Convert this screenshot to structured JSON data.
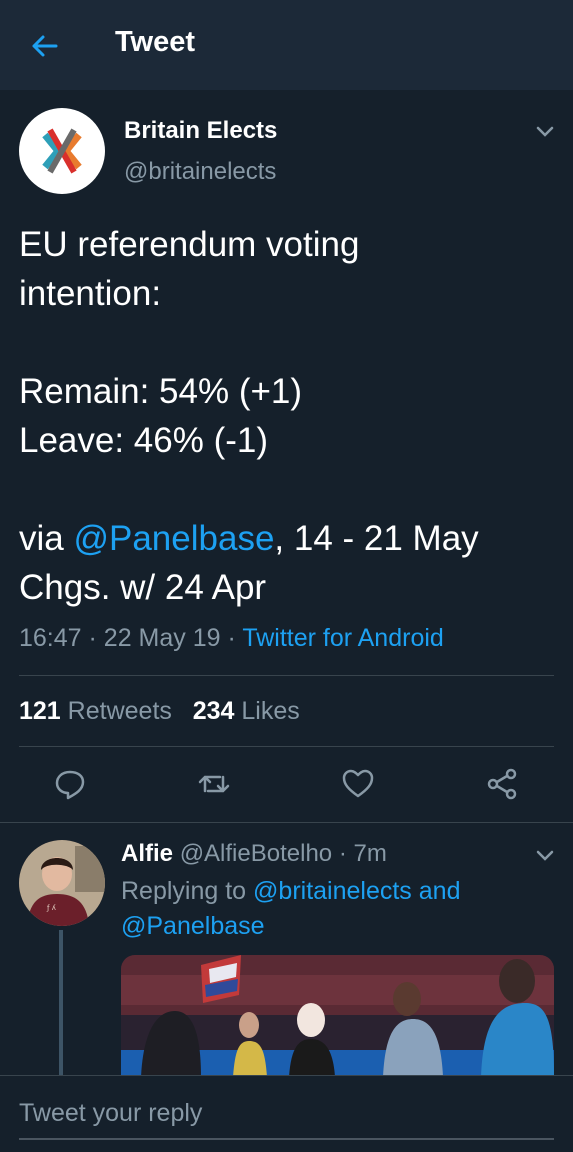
{
  "header": {
    "title": "Tweet"
  },
  "tweet": {
    "author_name": "Britain Elects",
    "author_handle": "@britainelects",
    "lines": [
      "EU referendum voting",
      "intention:",
      "",
      "Remain: 54% (+1)",
      "Leave: 46% (-1)",
      ""
    ],
    "via_prefix": "via ",
    "via_mention": "@Panelbase",
    "via_suffix": ", 14 - 21 May",
    "last_line": "Chgs. w/ 24 Apr",
    "time": "16:47",
    "date": "22 May 19",
    "app": "Twitter for Android",
    "dot": "·",
    "retweets_count": "121",
    "retweets_label": "Retweets",
    "likes_count": "234",
    "likes_label": "Likes"
  },
  "reply": {
    "name": "Alfie",
    "handle": "@AlfieBotelho",
    "age": "7m",
    "replying_prefix": "Replying to ",
    "mention1": "@britainelects",
    "conjunction": " and",
    "mention2": "@Panelbase"
  },
  "composer": {
    "placeholder": "Tweet your reply"
  },
  "colors": {
    "background": "#15202b",
    "header": "#1c2938",
    "accent": "#1da1f2",
    "muted": "#8899a6",
    "divider": "#38444d"
  },
  "icons": [
    "back-arrow-icon",
    "chevron-down-icon",
    "comment-icon",
    "retweet-icon",
    "heart-icon",
    "share-icon"
  ]
}
